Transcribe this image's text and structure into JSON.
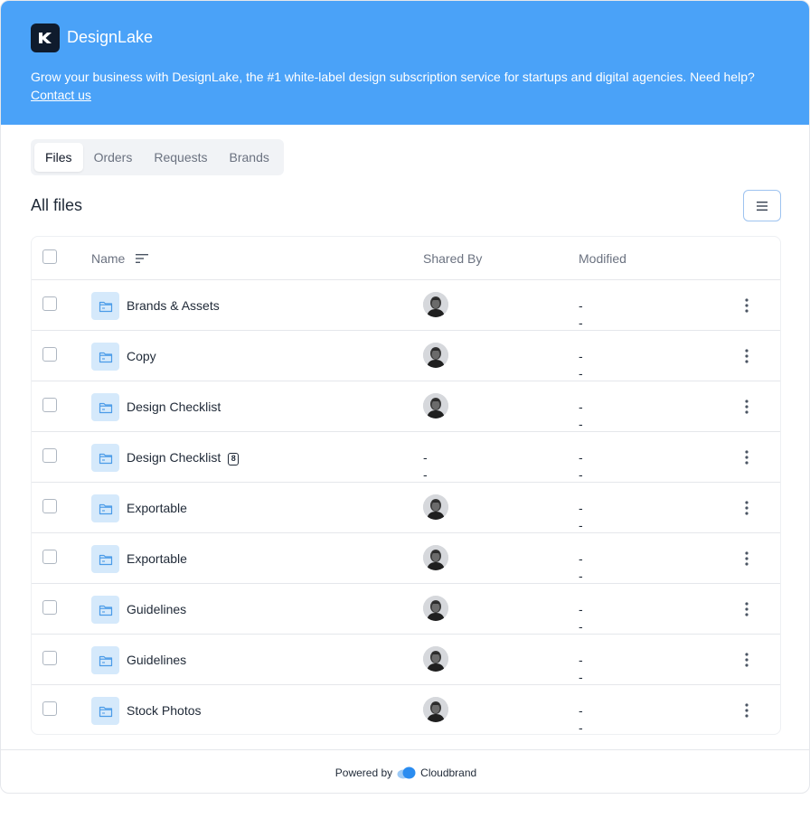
{
  "banner": {
    "brand_name": "DesignLake",
    "text": "Grow your business with DesignLake, the #1 white-label design subscription service for startups and digital agencies. Need help? ",
    "link": "Contact us",
    "color": "#4aa2f8"
  },
  "tabs": [
    {
      "label": "Files",
      "active": true
    },
    {
      "label": "Orders",
      "active": false
    },
    {
      "label": "Requests",
      "active": false
    },
    {
      "label": "Brands",
      "active": false
    }
  ],
  "page_title": "All files",
  "table": {
    "columns": {
      "name": "Name",
      "shared_by": "Shared By",
      "modified": "Modified"
    },
    "rows": [
      {
        "name": "Brands & Assets",
        "shared_by": "avatar",
        "modified_1": "-",
        "modified_2": "-"
      },
      {
        "name": "Copy",
        "shared_by": "avatar",
        "modified_1": "-",
        "modified_2": "-"
      },
      {
        "name": "Design Checklist",
        "shared_by": "avatar",
        "modified_1": "-",
        "modified_2": "-"
      },
      {
        "name": "Design Checklist",
        "badge": "8",
        "shared_by_1": "-",
        "shared_by_2": "-",
        "modified_1": "-",
        "modified_2": "-"
      },
      {
        "name": "Exportable",
        "shared_by": "avatar",
        "modified_1": "-",
        "modified_2": "-"
      },
      {
        "name": "Exportable",
        "shared_by": "avatar",
        "modified_1": "-",
        "modified_2": "-"
      },
      {
        "name": "Guidelines",
        "shared_by": "avatar",
        "modified_1": "-",
        "modified_2": "-"
      },
      {
        "name": "Guidelines",
        "shared_by": "avatar",
        "modified_1": "-",
        "modified_2": "-"
      },
      {
        "name": "Stock Photos",
        "shared_by": "avatar",
        "modified_1": "-",
        "modified_2": "-"
      }
    ]
  },
  "footer": {
    "powered_by": "Powered by",
    "brand": "Cloudbrand"
  },
  "icons": {
    "logo": "designlake-logo-icon",
    "menu": "hamburger-menu-icon",
    "sort": "sort-icon",
    "folder": "folder-icon",
    "kebab": "kebab-menu-icon",
    "cloud": "cloudbrand-logo-icon"
  }
}
